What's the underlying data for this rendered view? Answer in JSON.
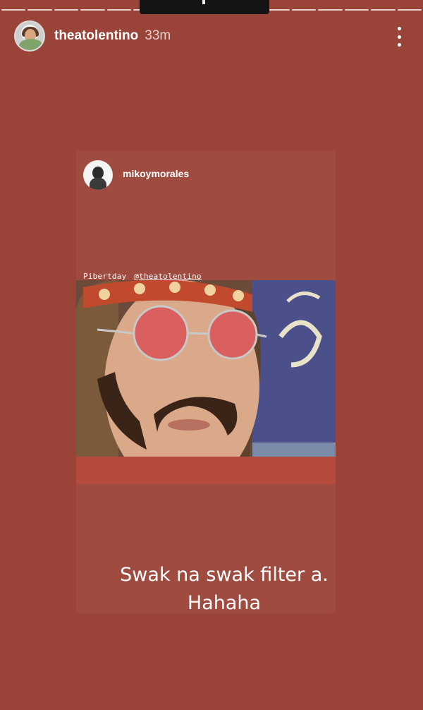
{
  "story": {
    "progress_segments": 16,
    "author": {
      "username": "theatolentino",
      "timestamp": "33m"
    },
    "menu_icon": "more-vertical-icon"
  },
  "shared_post": {
    "author": {
      "username": "mikoymorales"
    },
    "tag": {
      "text": "Pibertday",
      "mention": "@theatolentino"
    },
    "photo_description_icon": "selfie-photo"
  },
  "caption": {
    "line1": "Swak na swak filter a.",
    "line2": "Hahaha"
  },
  "colors": {
    "background": "#9a4338",
    "card": "#a04b40",
    "text": "#ffffff"
  }
}
